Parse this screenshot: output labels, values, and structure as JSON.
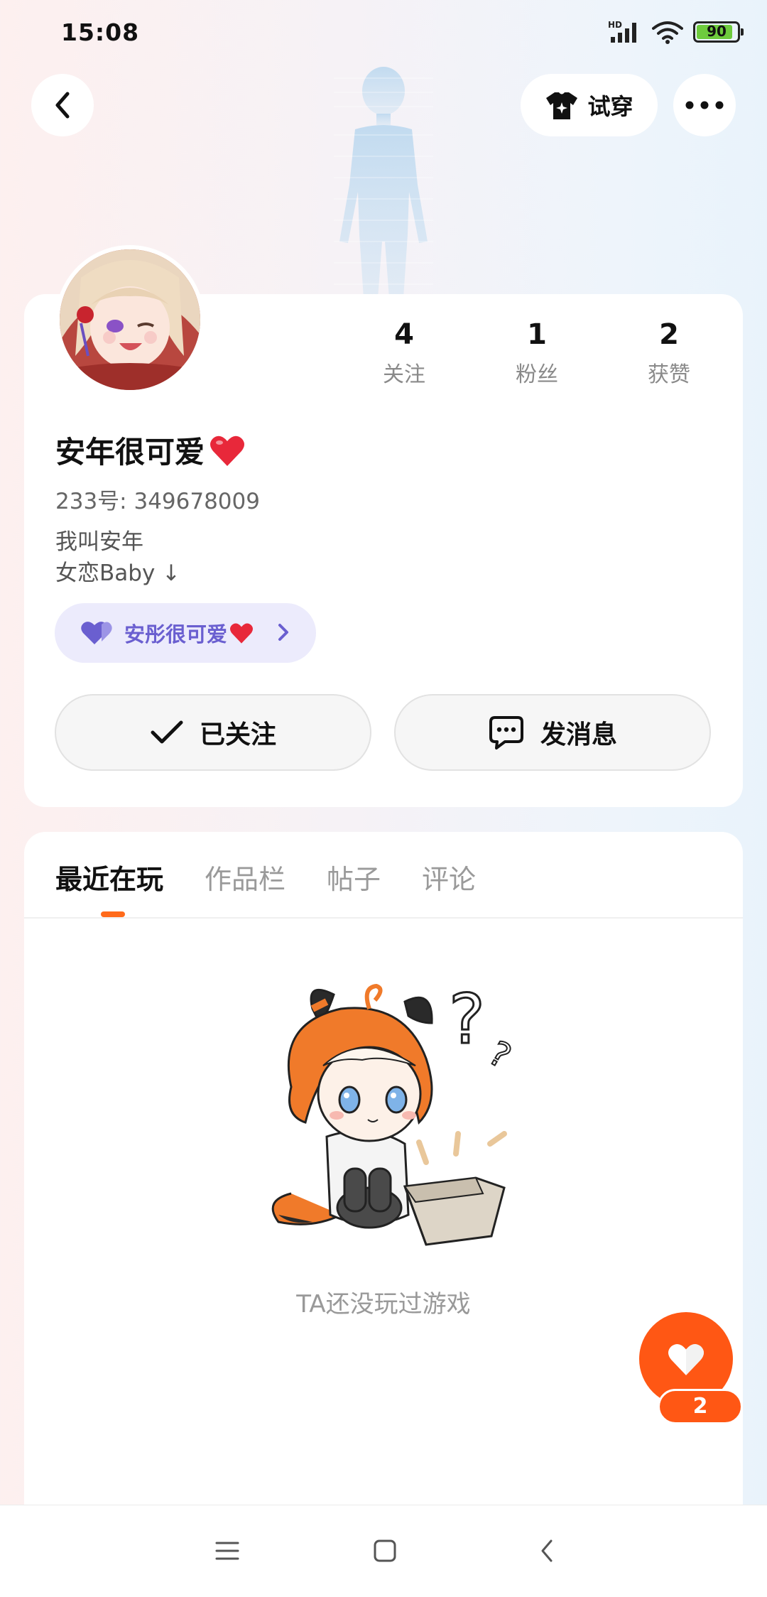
{
  "status_bar": {
    "time": "15:08",
    "battery": "90",
    "battery_level": 0.9,
    "network_badge": "HD",
    "icons": [
      "signal-icon",
      "wifi-icon",
      "battery-icon"
    ]
  },
  "header": {
    "try_on_label": "试穿",
    "icons": [
      "back-arrow-icon",
      "tshirt-sparkle-icon",
      "more-dots-icon"
    ]
  },
  "profile": {
    "stats": [
      {
        "value": "4",
        "label": "关注"
      },
      {
        "value": "1",
        "label": "粉丝"
      },
      {
        "value": "2",
        "label": "获赞"
      }
    ],
    "nickname": "安年很可爱",
    "uid": "233号: 349678009",
    "bio_lines": [
      "我叫安年",
      "女恋Baby ↓"
    ],
    "couple_tag": "安彤很可爱",
    "follow_button": "已关注",
    "message_button": "发消息"
  },
  "tabs": [
    {
      "label": "最近在玩",
      "active": true
    },
    {
      "label": "作品栏",
      "active": false
    },
    {
      "label": "帖子",
      "active": false
    },
    {
      "label": "评论",
      "active": false
    }
  ],
  "empty_state": {
    "message": "TA还没玩过游戏"
  },
  "like": {
    "count": "2"
  },
  "colors": {
    "accent": "#ff5714",
    "couple_tag_bg": "#ecebfc",
    "couple_tag_text": "#6a5fd0",
    "heart_red": "#e8283a"
  }
}
